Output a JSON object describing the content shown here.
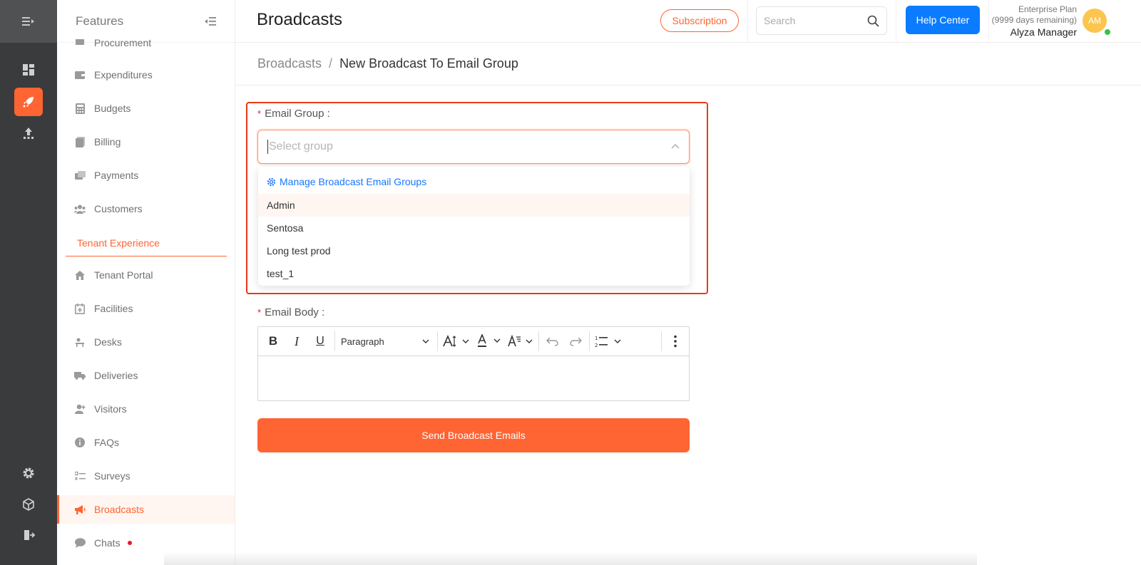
{
  "header": {
    "title": "Broadcasts",
    "subscription_label": "Subscription",
    "search_placeholder": "Search",
    "help_label": "Help Center",
    "plan_name": "Enterprise Plan",
    "plan_remaining": "(9999 days remaining)",
    "user_name": "Alyza Manager",
    "avatar_initials": "AM"
  },
  "sidebar": {
    "title": "Features",
    "partial_item": "Procurement",
    "items": [
      {
        "label": "Expenditures",
        "icon": "wallet-icon"
      },
      {
        "label": "Budgets",
        "icon": "calculator-icon"
      },
      {
        "label": "Billing",
        "icon": "receipt-icon"
      },
      {
        "label": "Payments",
        "icon": "payments-icon"
      },
      {
        "label": "Customers",
        "icon": "users-icon"
      }
    ],
    "section": "Tenant Experience",
    "tenant_items": [
      {
        "label": "Tenant Portal",
        "icon": "home-icon"
      },
      {
        "label": "Facilities",
        "icon": "calendar-plus-icon"
      },
      {
        "label": "Desks",
        "icon": "desk-icon"
      },
      {
        "label": "Deliveries",
        "icon": "truck-icon"
      },
      {
        "label": "Visitors",
        "icon": "visitor-icon"
      },
      {
        "label": "FAQs",
        "icon": "info-icon"
      },
      {
        "label": "Surveys",
        "icon": "checklist-icon"
      },
      {
        "label": "Broadcasts",
        "icon": "megaphone-icon"
      },
      {
        "label": "Chats",
        "icon": "chat-icon"
      }
    ],
    "active": "Broadcasts"
  },
  "breadcrumb": {
    "parent": "Broadcasts",
    "separator": "/",
    "current": "New Broadcast To Email Group"
  },
  "form": {
    "email_group_label": "Email Group",
    "select_placeholder": "Select group",
    "dropdown_manage": "Manage Broadcast Email Groups",
    "dropdown_options": [
      "Admin",
      "Sentosa",
      "Long test prod",
      "test_1"
    ],
    "email_body_label": "Email Body",
    "editor_block_format": "Paragraph",
    "submit_label": "Send Broadcast Emails"
  },
  "colors": {
    "accent": "#ff6433",
    "link": "#1677ff",
    "primary_button": "#0b7cff",
    "rail": "#3a3b3d"
  }
}
